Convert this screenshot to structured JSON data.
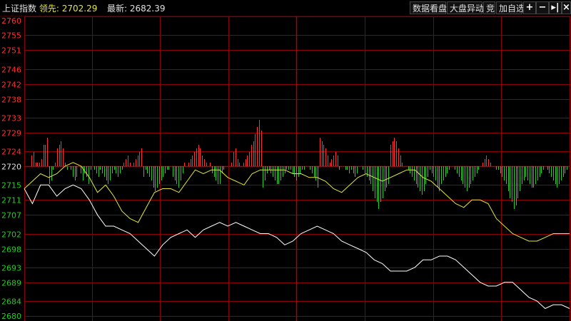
{
  "header": {
    "index_name": "上证指数",
    "lead_label": "领先:",
    "lead_value": "2702.29",
    "latest_label": "最新:",
    "latest_value": "2682.39",
    "buttons": [
      "数据看盘",
      "大盘异动",
      "竞",
      "加自选"
    ],
    "icons": [
      "plus-icon",
      "minus-icon",
      "arrow-right-bar-icon",
      "close-icon"
    ]
  },
  "colors": {
    "background": "#000000",
    "grid": "#8b0000",
    "up": "#ff3030",
    "down": "#22cc22",
    "price_line": "#ffffff",
    "lead_line": "#e6e63c"
  },
  "chart_data": {
    "type": "line",
    "reference_price": 2720,
    "y_ticks": [
      2760,
      2755,
      2751,
      2746,
      2742,
      2738,
      2733,
      2729,
      2724,
      2720,
      2715,
      2711,
      2707,
      2702,
      2698,
      2693,
      2689,
      2684,
      2680
    ],
    "ylim": [
      2680,
      2760
    ],
    "series": [
      {
        "key": "price",
        "values": [
          2714,
          2710,
          2715,
          2715,
          2712,
          2714,
          2715,
          2714,
          2711,
          2707,
          2704,
          2704,
          2703,
          2702,
          2700,
          2698,
          2696,
          2699,
          2701,
          2702,
          2703,
          2701,
          2703,
          2704,
          2705,
          2704,
          2705,
          2704,
          2703,
          2702,
          2702,
          2701,
          2699,
          2700,
          2702,
          2703,
          2704,
          2703,
          2702,
          2700,
          2699,
          2698,
          2697,
          2695,
          2694,
          2692,
          2692,
          2692,
          2693,
          2695,
          2695,
          2696,
          2696,
          2695,
          2693,
          2691,
          2689,
          2688,
          2688,
          2689,
          2689,
          2687,
          2685,
          2684,
          2682,
          2683,
          2683,
          2682
        ]
      },
      {
        "key": "lead",
        "values": [
          2714,
          2716,
          2718,
          2717,
          2718,
          2720,
          2721,
          2720,
          2717,
          2713,
          2715,
          2712,
          2708,
          2706,
          2705,
          2709,
          2713,
          2714,
          2714,
          2713,
          2716,
          2719,
          2718,
          2719,
          2719,
          2717,
          2716,
          2715,
          2718,
          2719,
          2719,
          2719,
          2719,
          2718,
          2718,
          2717,
          2717,
          2716,
          2714,
          2713,
          2715,
          2717,
          2718,
          2717,
          2716,
          2717,
          2718,
          2719,
          2719,
          2717,
          2716,
          2714,
          2712,
          2710,
          2709,
          2711,
          2711,
          2710,
          2706,
          2704,
          2702,
          2701,
          2700,
          2700,
          2701,
          2702,
          2702,
          2702
        ]
      }
    ],
    "volume_bars": [
      0,
      0,
      0,
      3,
      4,
      1,
      1,
      1,
      2,
      6,
      6,
      8,
      5,
      4,
      1,
      1,
      5,
      6,
      7,
      5,
      1,
      1,
      0,
      1,
      3,
      4,
      3,
      0,
      2,
      4,
      2,
      3,
      5,
      1,
      0,
      1,
      2,
      3,
      1,
      2,
      3,
      4,
      5,
      4,
      2,
      1,
      2,
      3,
      2,
      1,
      1,
      2,
      3,
      1,
      0,
      1,
      2,
      3,
      4,
      5,
      3,
      1,
      2,
      3,
      4,
      6,
      7,
      6,
      5,
      4,
      3,
      2,
      1,
      1,
      0,
      3,
      4,
      5,
      6,
      4,
      2,
      1,
      0,
      1,
      2,
      3,
      4,
      5,
      6,
      5,
      3,
      2,
      1,
      0,
      1,
      2,
      3,
      4,
      5,
      5,
      2,
      1,
      0,
      0,
      0,
      1,
      4,
      5,
      2,
      1,
      0,
      1,
      2,
      3,
      4,
      6,
      7,
      9,
      11,
      13,
      10,
      6,
      4,
      2,
      1,
      2,
      3,
      4,
      5,
      5,
      4,
      3,
      2,
      1,
      1,
      1,
      2,
      3,
      4,
      3,
      2,
      1,
      1,
      0,
      0,
      1,
      2,
      3,
      4,
      6,
      8,
      7,
      6,
      5,
      3,
      1,
      2,
      3,
      4,
      3,
      1,
      0,
      0,
      1,
      1,
      2,
      1,
      2,
      3,
      2,
      0,
      0,
      1,
      2,
      3,
      4,
      5,
      7,
      9,
      10,
      12,
      10,
      9,
      7,
      6,
      5,
      6,
      7,
      8,
      7,
      5,
      3,
      1,
      0,
      0,
      1,
      2,
      3,
      4,
      5,
      6,
      7,
      8,
      7,
      5,
      3,
      1,
      2,
      3,
      4,
      6,
      7,
      5,
      4,
      3,
      2,
      1,
      0,
      0,
      1,
      2,
      3,
      4,
      5,
      6,
      7,
      6,
      5,
      4,
      3,
      2,
      1,
      0,
      1,
      2,
      3,
      2,
      1,
      0,
      0,
      1,
      1,
      2,
      3,
      4,
      5,
      7,
      9,
      10,
      12,
      11,
      9,
      7,
      5,
      4,
      3,
      4,
      5,
      6,
      6,
      5,
      4,
      3,
      2,
      1,
      0,
      1,
      2,
      3,
      4,
      5,
      6,
      5,
      4,
      3,
      2,
      1
    ],
    "volume_sign": [
      1,
      1,
      1,
      1,
      1,
      1,
      1,
      1,
      1,
      1,
      1,
      1,
      -1,
      -1,
      -1,
      1,
      1,
      1,
      1,
      1,
      1,
      -1,
      -1,
      -1,
      -1,
      -1,
      -1,
      -1,
      -1,
      -1,
      -1,
      -1,
      -1,
      -1,
      -1,
      -1,
      -1,
      -1,
      -1,
      -1,
      -1,
      -1,
      -1,
      -1,
      -1,
      -1,
      -1,
      -1,
      -1,
      -1,
      1,
      1,
      1,
      1,
      1,
      1,
      1,
      1,
      1,
      1,
      -1,
      -1,
      -1,
      -1,
      -1,
      -1,
      -1,
      -1,
      -1,
      -1,
      -1,
      -1,
      -1,
      -1,
      -1,
      -1,
      -1,
      -1,
      -1,
      -1,
      -1,
      1,
      1,
      1,
      1,
      1,
      1,
      1,
      1,
      1,
      1,
      1,
      1,
      1,
      1,
      -1,
      -1,
      -1,
      -1,
      -1,
      -1,
      -1,
      -1,
      -1,
      1,
      1,
      1,
      1,
      1,
      1,
      1,
      1,
      1,
      1,
      1,
      1,
      1,
      1,
      1,
      1,
      1,
      -1,
      -1,
      -1,
      -1,
      -1,
      -1,
      -1,
      -1,
      -1,
      -1,
      -1,
      -1,
      -1,
      -1,
      -1,
      -1,
      -1,
      -1,
      -1,
      -1,
      -1,
      -1,
      -1,
      -1,
      -1,
      -1,
      -1,
      -1,
      -1,
      1,
      1,
      1,
      1,
      1,
      1,
      1,
      1,
      1,
      1,
      -1,
      -1,
      -1,
      -1,
      -1,
      -1,
      -1,
      -1,
      -1,
      -1,
      -1,
      -1,
      -1,
      -1,
      -1,
      -1,
      -1,
      -1,
      -1,
      -1,
      -1,
      -1,
      -1,
      -1,
      -1,
      -1,
      1,
      1,
      1,
      1,
      1,
      1,
      1,
      1,
      1,
      -1,
      -1,
      -1,
      -1,
      -1,
      -1,
      -1,
      -1,
      -1,
      -1,
      -1,
      -1,
      -1,
      -1,
      -1,
      -1,
      -1,
      -1,
      -1,
      -1,
      -1,
      -1,
      -1,
      -1,
      -1,
      -1,
      -1,
      -1,
      -1,
      -1,
      -1,
      -1,
      -1,
      -1,
      -1,
      -1,
      -1,
      1,
      1,
      1,
      1,
      1,
      1,
      -1,
      -1,
      -1,
      -1,
      -1,
      -1,
      -1,
      -1,
      -1,
      -1,
      -1,
      -1,
      -1,
      -1,
      -1,
      -1,
      -1,
      -1,
      -1,
      -1,
      -1,
      -1,
      -1,
      -1,
      -1,
      -1,
      -1,
      -1,
      -1,
      -1,
      -1,
      -1,
      -1,
      -1,
      -1,
      -1,
      -1,
      -1,
      -1,
      -1,
      -1,
      -1,
      -1,
      -1,
      -1,
      -1,
      -1,
      -1,
      1,
      1,
      1,
      1,
      1,
      1,
      1,
      1
    ]
  }
}
